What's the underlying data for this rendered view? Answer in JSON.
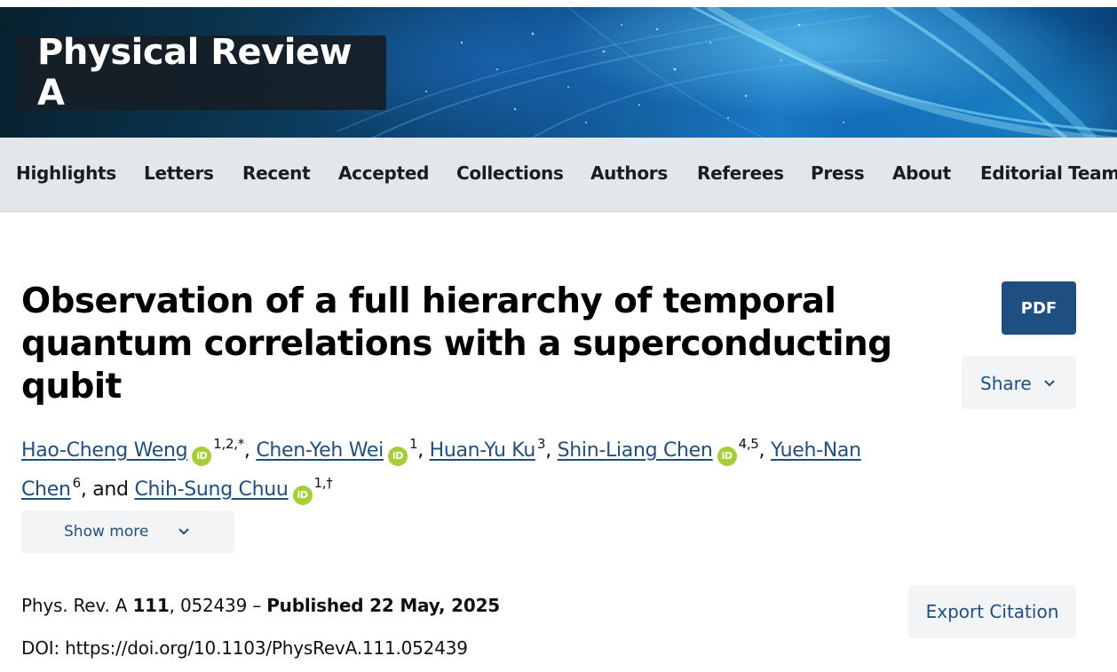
{
  "banner": {
    "journal_title": "Physical Review A"
  },
  "nav": {
    "items": [
      "Highlights",
      "Letters",
      "Recent",
      "Accepted",
      "Collections",
      "Authors",
      "Referees",
      "Press",
      "About",
      "Editorial Team"
    ]
  },
  "article": {
    "title_line1": "Observation of a full hierarchy of temporal",
    "title_line2": "quantum correlations with a superconducting",
    "title_line3": "qubit",
    "authors": [
      {
        "name": "Hao-Cheng Weng",
        "orcid": "iD",
        "affil": "1,2,*"
      },
      {
        "name": "Chen-Yeh Wei",
        "orcid": "iD",
        "affil": "1"
      },
      {
        "name": "Huan-Yu Ku",
        "affil": "3"
      },
      {
        "name": "Shin-Liang Chen",
        "orcid": "iD",
        "affil": "4,5"
      },
      {
        "name_part1": "Yueh-Nan",
        "name_part2": "Chen",
        "affil": "6"
      },
      {
        "name": "Chih-Sung Chuu",
        "orcid": "iD",
        "affil": "1,†"
      }
    ],
    "sep_comma": ",",
    "sep_and": ", and",
    "show_more_label": "Show more"
  },
  "citation": {
    "journal": "Phys. Rev. A",
    "volume": "111",
    "article_number": ", 052439 –",
    "published": "Published 22 May, 2025",
    "doi_label": "DOI:",
    "doi_url": "https://doi.org/10.1103/PhysRevA.111.052439"
  },
  "actions": {
    "pdf_label": "PDF",
    "share_label": "Share",
    "export_label": "Export Citation"
  },
  "colors": {
    "link": "#1f4e80",
    "primary_button": "#1f4e80",
    "orcid": "#a6ce39",
    "nav_bg": "#e4e7ea"
  }
}
